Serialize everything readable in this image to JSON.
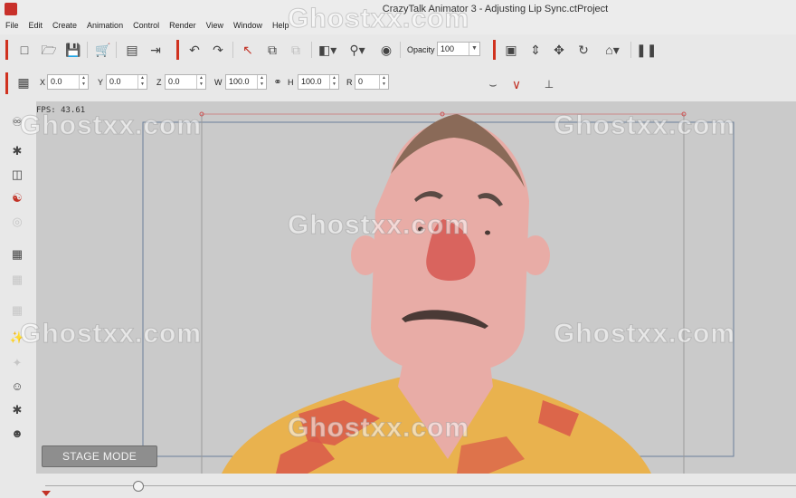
{
  "window": {
    "title": "CrazyTalk Animator 3   - Adjusting Lip Sync.ctProject"
  },
  "menu": {
    "items": [
      "File",
      "Edit",
      "Create",
      "Animation",
      "Control",
      "Render",
      "View",
      "Window",
      "Help"
    ]
  },
  "toolbar": {
    "opacity_label": "Opacity :",
    "opacity_value": "100"
  },
  "transform": {
    "x_label": "X",
    "x_value": "0.0",
    "y_label": "Y",
    "y_value": "0.0",
    "z_label": "Z",
    "z_value": "0.0",
    "w_label": "W",
    "w_value": "100.0",
    "h_label": "H",
    "h_value": "100.0",
    "r_label": "R",
    "r_value": "0"
  },
  "stage": {
    "fps_text": "FPS: 43.61",
    "mode_button": "STAGE MODE",
    "background_color": "#cacaca",
    "skin_color": "#e8aca6",
    "hair_color": "#8a6a58",
    "nose_color": "#d9645e",
    "shirt_color": "#e9b24e"
  },
  "watermark": {
    "text": "Ghostxx.com"
  },
  "accent_color": "#d0321f"
}
